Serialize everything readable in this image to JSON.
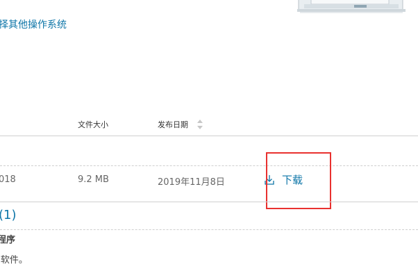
{
  "header": {
    "os_link": "择其他操作系统"
  },
  "table": {
    "columns": {
      "size": "文件大小",
      "date": "发布日期"
    },
    "row": {
      "version_fragment": "018",
      "size": "9.2 MB",
      "date": "2019年11月8日",
      "download_label": "下载"
    }
  },
  "section": {
    "count": "(1)",
    "title": "程序",
    "description": "J软件。"
  },
  "colors": {
    "link": "#0e76a8",
    "highlight": "#e8312f",
    "divider": "#cfcfcf"
  }
}
